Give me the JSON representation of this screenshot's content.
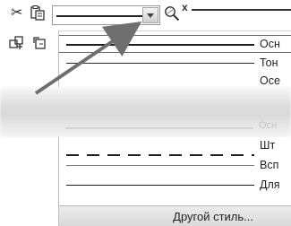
{
  "toolbar": {
    "icons": [
      "cut-icon",
      "paste-icon",
      "line-style-combo",
      "zoom-icon",
      "close-icon"
    ],
    "close_glyph": "x"
  },
  "left_tools": {
    "icons": [
      "move-icon",
      "rotate-icon"
    ]
  },
  "line_styles": [
    {
      "label": "Осн",
      "pattern": "solid-thick",
      "selected": true
    },
    {
      "label": "Тон",
      "pattern": "solid-thin",
      "selected": false
    },
    {
      "label": "Осе",
      "pattern": "dash-dot",
      "selected": false
    },
    {
      "label": "Осн",
      "pattern": "solid-thick-faint",
      "selected": false
    },
    {
      "label": "Шт",
      "pattern": "dashed-thick",
      "selected": false
    },
    {
      "label": "Всп",
      "pattern": "solid-thin-gray",
      "selected": false
    },
    {
      "label": "Для",
      "pattern": "solid-medium",
      "selected": false
    }
  ],
  "footer": {
    "other_style_label": "Другой стиль..."
  },
  "colors": {
    "arrow": "#6f6f6f",
    "footer_bg": "#e2e2e2"
  }
}
